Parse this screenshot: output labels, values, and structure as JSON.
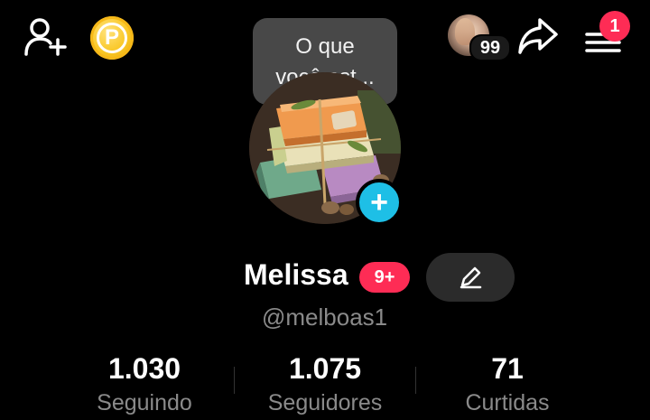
{
  "header": {
    "add_friend_icon": "person-plus-icon",
    "points_letter": "P",
    "visitors_count": "99",
    "share_icon": "share-arrow-icon",
    "menu_icon": "hamburger-menu-icon",
    "menu_notification_count": "1"
  },
  "bubble": {
    "line1": "O que",
    "line2": "você est..."
  },
  "profile": {
    "name": "Melissa",
    "badge": "9+",
    "handle": "@melboas1",
    "edit_icon": "pencil-icon",
    "add_story_symbol": "+"
  },
  "stats": [
    {
      "value": "1.030",
      "label": "Seguindo"
    },
    {
      "value": "1.075",
      "label": "Seguidores"
    },
    {
      "value": "71",
      "label": "Curtidas"
    }
  ],
  "colors": {
    "background": "#000000",
    "accent_red": "#fe2c55",
    "accent_cyan": "#1ebfe6",
    "coin_gold": "#f9c623",
    "muted_text": "#8a8a8a"
  }
}
